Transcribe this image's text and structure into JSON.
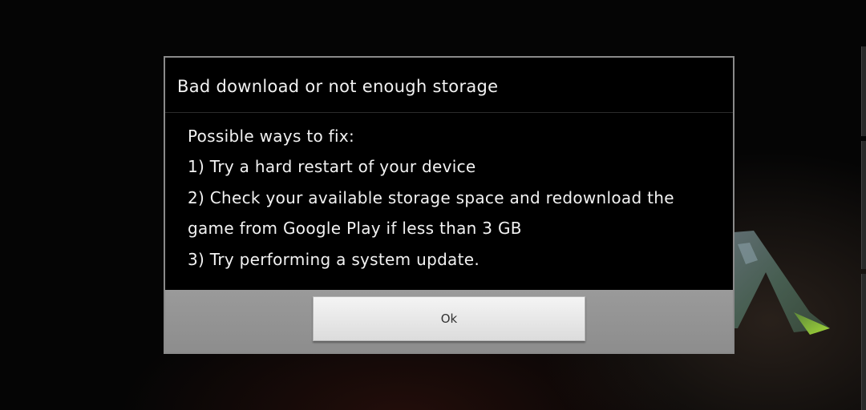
{
  "dialog": {
    "title": "Bad download or not enough storage",
    "message_lines": [
      "Possible ways to fix:",
      "1) Try a hard restart of your device",
      "2) Check your available storage space and redownload the",
      "game from Google Play if less than 3 GB",
      "3) Try performing a system update."
    ],
    "ok_label": "Ok"
  },
  "background": {
    "logo_icon": "ark-logo-icon"
  },
  "colors": {
    "dialog_bg": "#000000",
    "footer_bg": "#8d8d8d",
    "button_bg": "#e8e8e8",
    "text": "#f2f2f2"
  }
}
